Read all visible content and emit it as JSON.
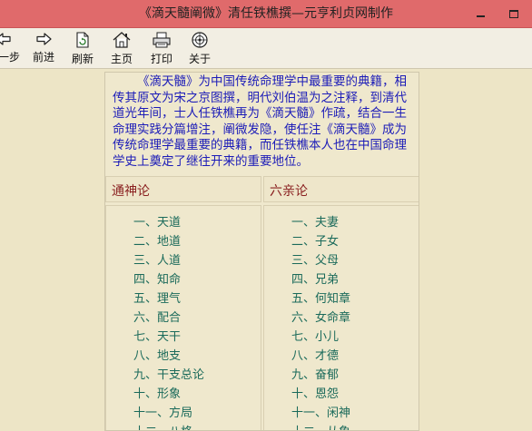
{
  "window": {
    "title": "《滴天髓阐微》清任铁樵撰—元亨利贞网制作"
  },
  "toolbar": {
    "back_label": "上一步",
    "forward_label": "前进",
    "refresh_label": "刷新",
    "home_label": "主页",
    "print_label": "打印",
    "about_label": "关于"
  },
  "intro": {
    "text": "《滴天髓》为中国传统命理学中最重要的典籍，相传其原文为宋之京图撰，明代刘伯温为之注释，到清代道光年间，士人任铁樵再为《滴天髓》作疏，结合一生命理实践分篇增注，阐微发隐，使任注《滴天髓》成为传统命理学最重要的典籍，而任铁樵本人也在中国命理学史上奠定了继往开来的重要地位。"
  },
  "columns": {
    "left": {
      "heading": "通神论",
      "items": [
        "一、天道",
        "二、地道",
        "三、人道",
        "四、知命",
        "五、理气",
        "六、配合",
        "七、天干",
        "八、地支",
        "九、干支总论",
        "十、形象",
        "十一、方局",
        "十二、八格"
      ]
    },
    "right": {
      "heading": "六亲论",
      "items": [
        "一、夫妻",
        "二、子女",
        "三、父母",
        "四、兄弟",
        "五、何知章",
        "六、女命章",
        "七、小儿",
        "八、才德",
        "九、奋郁",
        "十、恩怨",
        "十一、闲神",
        "十二、从象"
      ]
    }
  },
  "colors": {
    "titlebar": "#e06a6b",
    "intro_text": "#1c1cb8",
    "heading_text": "#8a2020",
    "link_text": "#1a6a5a",
    "background": "#ede5c6"
  }
}
